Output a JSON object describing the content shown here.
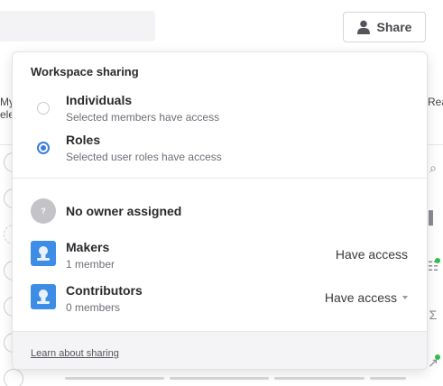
{
  "header": {
    "share_label": "Share",
    "share_icon": "person-icon"
  },
  "background": {
    "left_text_line1": "My",
    "left_text_line2": "ele",
    "right_text": "Rea"
  },
  "popover": {
    "title": "Workspace sharing",
    "options": [
      {
        "label": "Individuals",
        "sub": "Selected members have access",
        "selected": false
      },
      {
        "label": "Roles",
        "sub": "Selected user roles have access",
        "selected": true
      }
    ],
    "owner": {
      "icon_text": "?",
      "label": "No owner assigned"
    },
    "roles": [
      {
        "name": "Makers",
        "count": "1 member",
        "access": "Have access",
        "dropdown": false
      },
      {
        "name": "Contributors",
        "count": "0 members",
        "access": "Have access",
        "dropdown": true
      }
    ],
    "footer_link": "Learn about sharing"
  },
  "colors": {
    "accent": "#3b7ddd",
    "role_avatar": "#3d8ce6",
    "status_dot": "#2fbf4a"
  }
}
